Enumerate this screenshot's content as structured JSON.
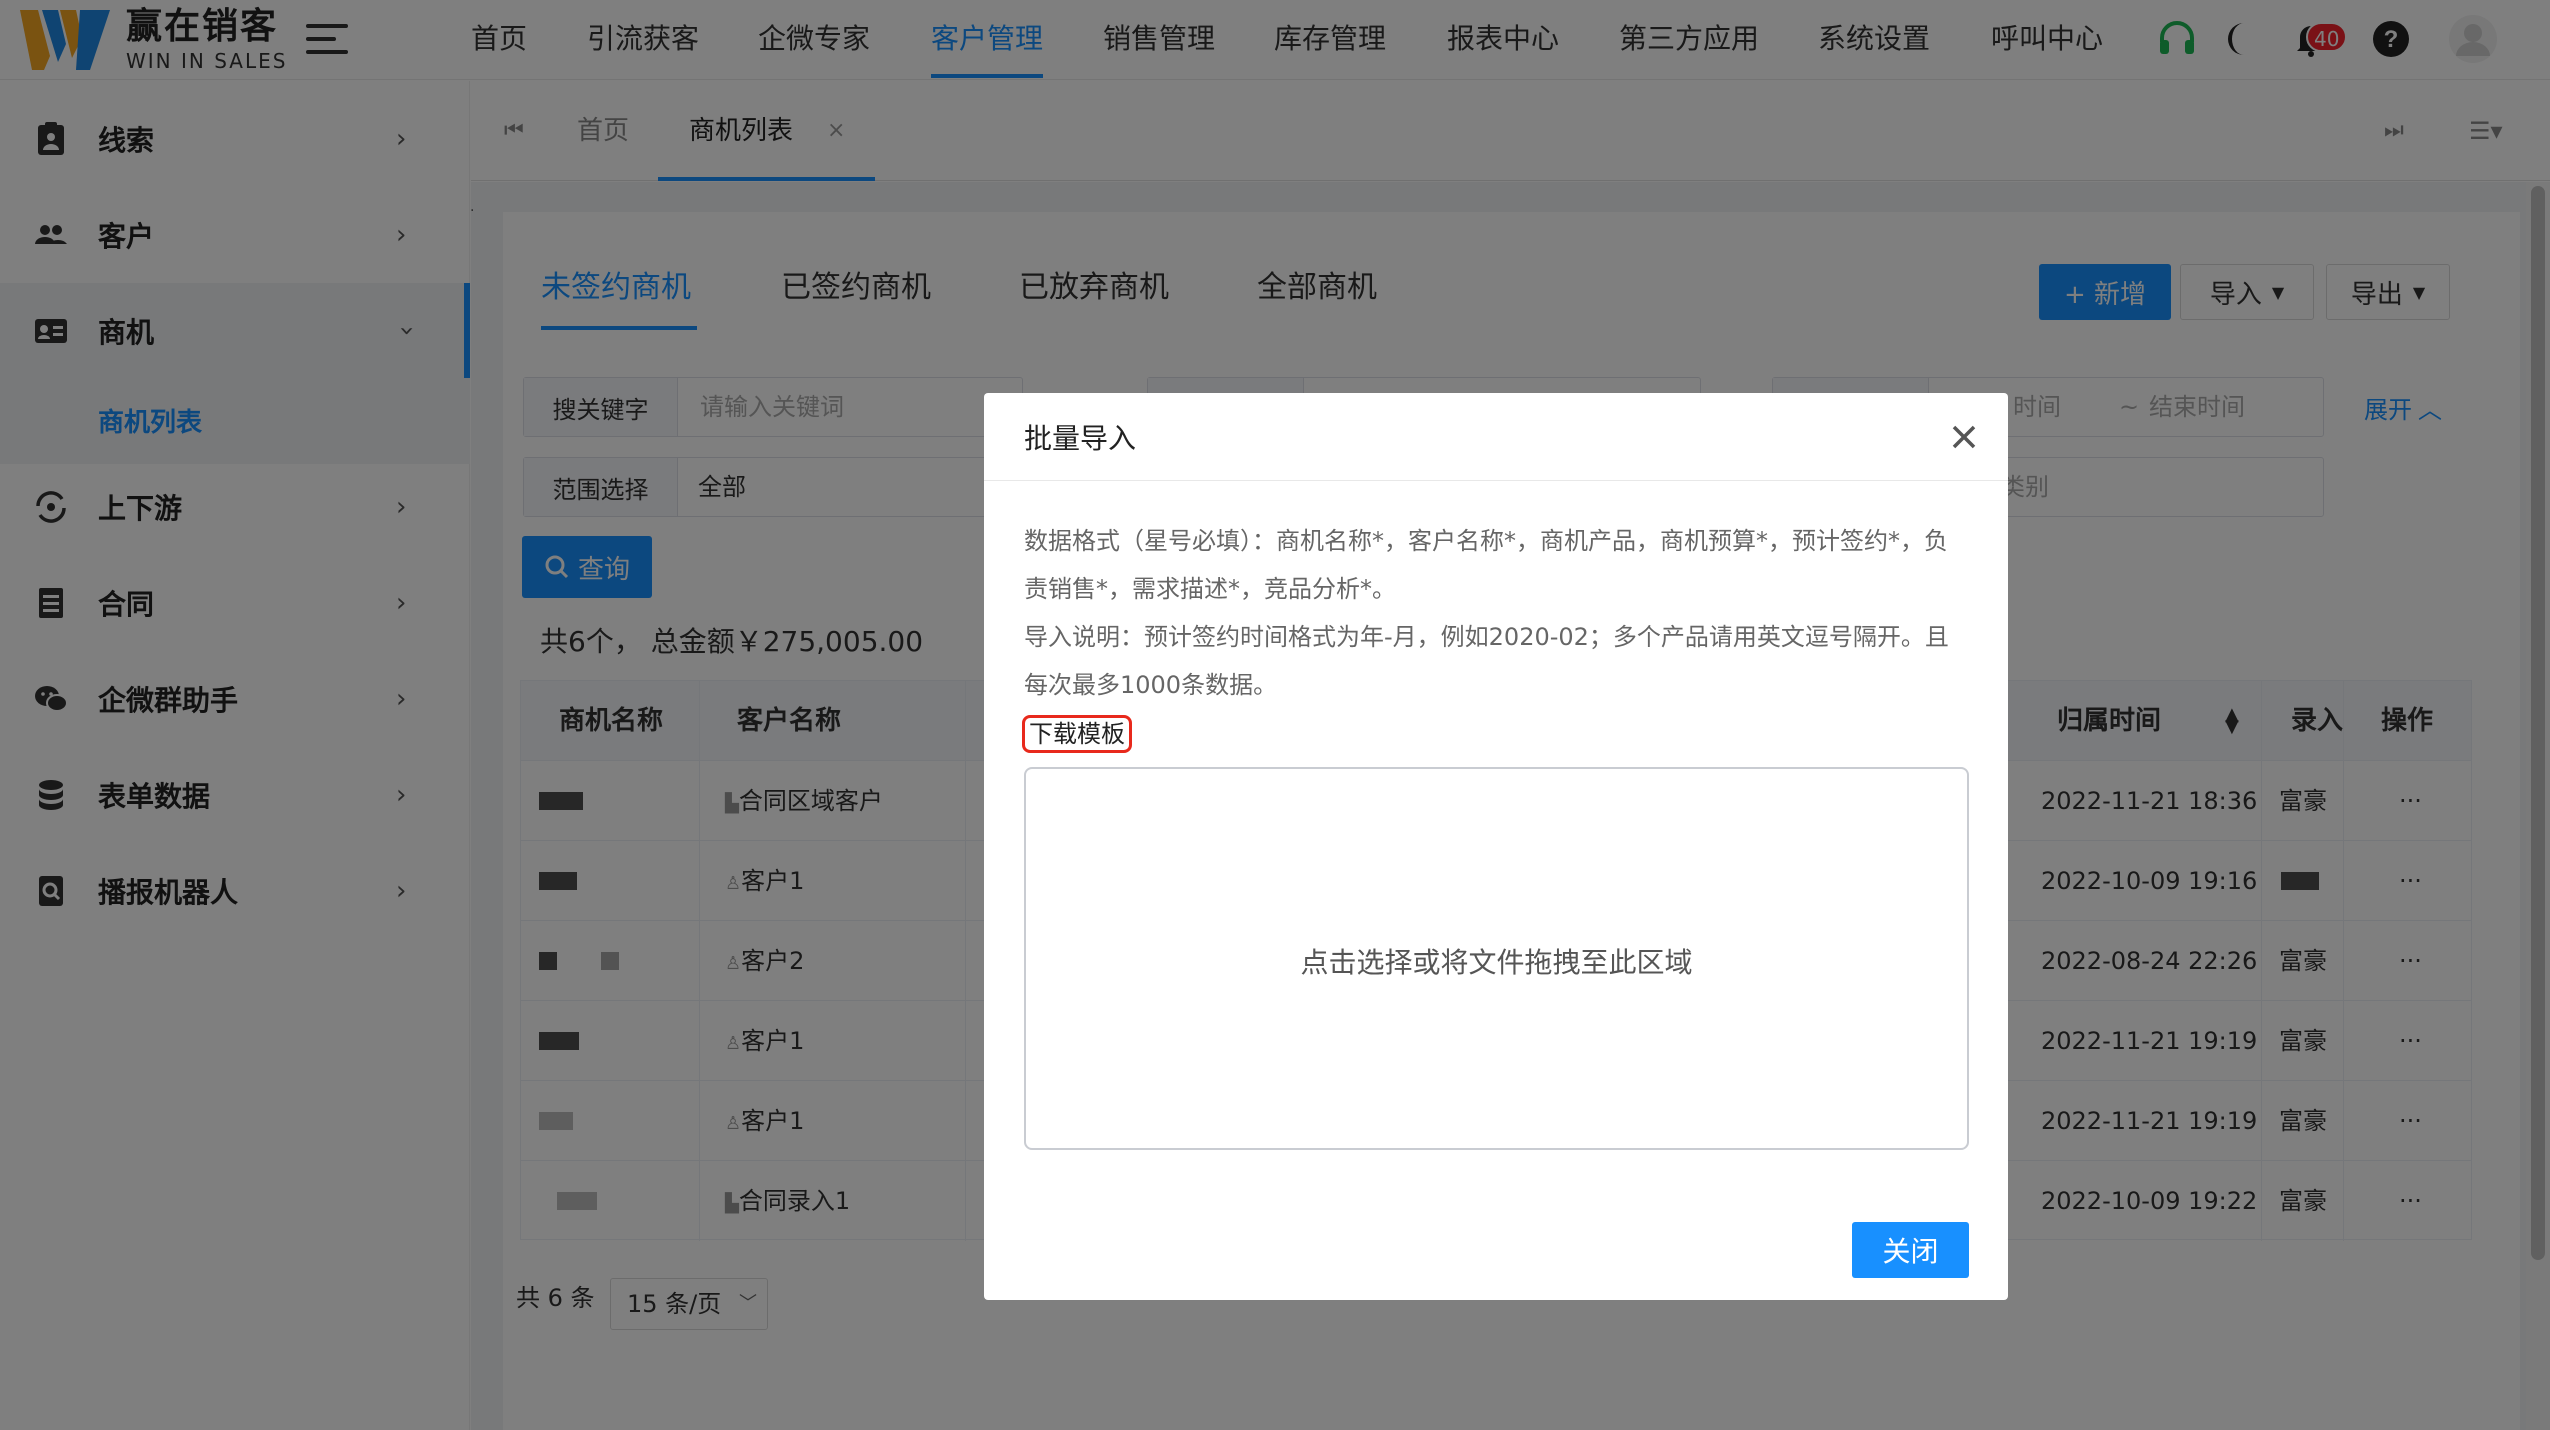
{
  "header": {
    "logo_cn": "赢在销客",
    "logo_en": "WIN IN SALES",
    "nav": [
      "首页",
      "引流获客",
      "企微专家",
      "客户管理",
      "销售管理",
      "库存管理",
      "报表中心",
      "第三方应用",
      "系统设置",
      "呼叫中心"
    ],
    "active_nav": "客户管理",
    "notification_count": "40",
    "colors": {
      "accent": "#1890ff",
      "headset": "#1db954",
      "badge": "#f5222d"
    }
  },
  "sidebar": {
    "items": [
      {
        "label": "线索",
        "icon": "clipboard-icon"
      },
      {
        "label": "客户",
        "icon": "users-icon"
      },
      {
        "label": "商机",
        "icon": "id-card-icon"
      },
      {
        "label": "上下游",
        "icon": "sync-icon"
      },
      {
        "label": "合同",
        "icon": "document-icon"
      },
      {
        "label": "企微群助手",
        "icon": "wechat-icon"
      },
      {
        "label": "表单数据",
        "icon": "database-icon"
      },
      {
        "label": "播报机器人",
        "icon": "search-doc-icon"
      }
    ],
    "sub_active": "商机列表"
  },
  "tabs": {
    "home": "首页",
    "current": "商机列表",
    "close": "×"
  },
  "content": {
    "subtabs": [
      "未签约商机",
      "已签约商机",
      "已放弃商机",
      "全部商机"
    ],
    "buttons": {
      "add": "+ 新增",
      "import": "导入",
      "export": "导出",
      "query": "查询",
      "expand": "展开"
    },
    "search": {
      "label": "搜关键字",
      "placeholder": "请输入关键词"
    },
    "scope": {
      "label": "范围选择",
      "value": "全部"
    },
    "date": {
      "start_tail": "时间",
      "sep": "~",
      "end": "结束时间"
    },
    "category_tail": "类别",
    "summary": "共6个，  总金额￥275,005.00",
    "table": {
      "headers": [
        "商机名称",
        "客户名称",
        "归属时间",
        "录入",
        "操作"
      ],
      "rows": [
        {
          "customer": "合同区域客户",
          "time": "2022-11-21 18:36",
          "by": "富豪",
          "op": "···"
        },
        {
          "customer": "客户1",
          "time": "2022-10-09 19:16",
          "by": "",
          "op": "···"
        },
        {
          "customer": "客户2",
          "time": "2022-08-24 22:26",
          "by": "富豪",
          "op": "···"
        },
        {
          "customer": "客户1",
          "time": "2022-11-21 19:19",
          "by": "富豪",
          "op": "···"
        },
        {
          "customer": "客户1",
          "time": "2022-11-21 19:19",
          "by": "富豪",
          "op": "···"
        },
        {
          "customer": "合同录入1",
          "time": "2022-10-09 19:22",
          "by": "富豪",
          "op": "···"
        }
      ]
    },
    "pager": {
      "total": "共 6 条",
      "size": "15 条/页"
    }
  },
  "modal": {
    "title": "批量导入",
    "format_line1": "数据格式（星号必填）：商机名称*，客户名称*，商机产品，商机预算*，预计签约*，负",
    "format_line2": "责销售*，需求描述*，竞品分析*。",
    "note_line1": "导入说明：预计签约时间格式为年-月，例如2020-02；多个产品请用英文逗号隔开。且",
    "note_line2": "每次最多1000条数据。",
    "download": "下载模板",
    "dropzone": "点击选择或将文件拖拽至此区域",
    "close_button": "关闭"
  }
}
